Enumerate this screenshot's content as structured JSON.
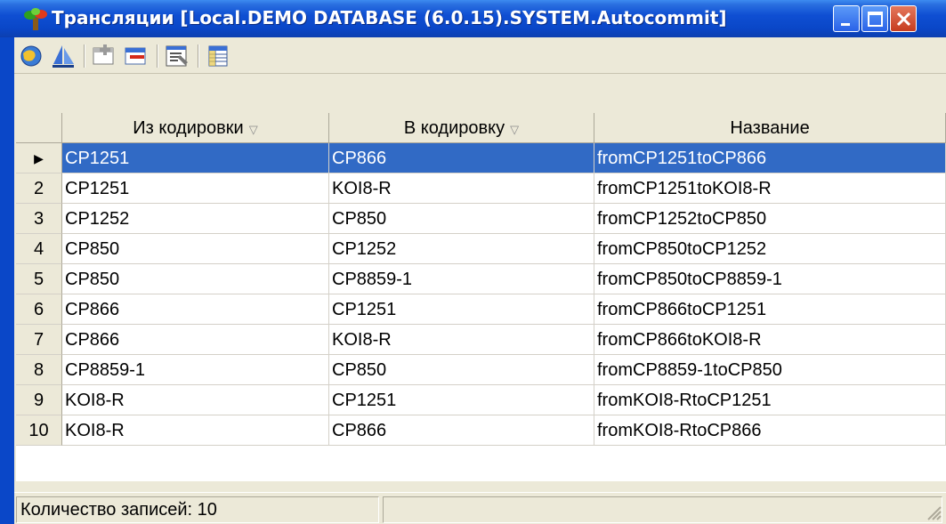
{
  "window": {
    "title": "Трансляции [Local.DEMO DATABASE (6.0.15).SYSTEM.Autocommit]"
  },
  "toolbar": {
    "buttons": [
      {
        "icon": "refresh-globe-icon"
      },
      {
        "icon": "sail-icon"
      },
      {
        "icon": "add-row-icon"
      },
      {
        "icon": "delete-row-icon"
      },
      {
        "icon": "properties-icon"
      },
      {
        "icon": "table-icon"
      }
    ]
  },
  "grid": {
    "columns": [
      "Из кодировки",
      "В кодировку",
      "Название"
    ],
    "sort_glyph": "▽",
    "selected_marker": "▶",
    "rows": [
      {
        "num": "",
        "from": "CP1251",
        "to": "CP866",
        "name": "fromCP1251toCP866"
      },
      {
        "num": "2",
        "from": "CP1251",
        "to": "KOI8-R",
        "name": "fromCP1251toKOI8-R"
      },
      {
        "num": "3",
        "from": "CP1252",
        "to": "CP850",
        "name": "fromCP1252toCP850"
      },
      {
        "num": "4",
        "from": "CP850",
        "to": "CP1252",
        "name": "fromCP850toCP1252"
      },
      {
        "num": "5",
        "from": "CP850",
        "to": "CP8859-1",
        "name": "fromCP850toCP8859-1"
      },
      {
        "num": "6",
        "from": "CP866",
        "to": "CP1251",
        "name": "fromCP866toCP1251"
      },
      {
        "num": "7",
        "from": "CP866",
        "to": "KOI8-R",
        "name": "fromCP866toKOI8-R"
      },
      {
        "num": "8",
        "from": "CP8859-1",
        "to": "CP850",
        "name": "fromCP8859-1toCP850"
      },
      {
        "num": "9",
        "from": "KOI8-R",
        "to": "CP1251",
        "name": "fromKOI8-RtoCP1251"
      },
      {
        "num": "10",
        "from": "KOI8-R",
        "to": "CP866",
        "name": "fromKOI8-RtoCP866"
      }
    ]
  },
  "status": {
    "records": "Количество записей: 10"
  },
  "colors": {
    "titlebar": "#0a47c8",
    "selection": "#316ac5",
    "close": "#c63c1f"
  }
}
